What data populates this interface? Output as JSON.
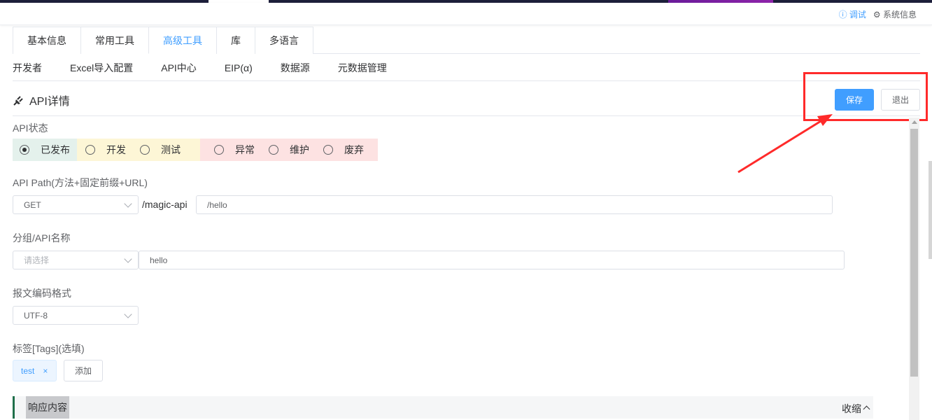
{
  "header": {
    "debug_link": "ⓘ 调试",
    "sysinfo_link": "⚙ 系统信息"
  },
  "tabs": [
    {
      "label": "基本信息"
    },
    {
      "label": "常用工具"
    },
    {
      "label": "高级工具",
      "active": true
    },
    {
      "label": "库"
    },
    {
      "label": "多语言"
    }
  ],
  "subnav": [
    {
      "label": "开发者"
    },
    {
      "label": "Excel导入配置"
    },
    {
      "label": "API中心"
    },
    {
      "label": "EIP(α)"
    },
    {
      "label": "数据源"
    },
    {
      "label": "元数据管理"
    }
  ],
  "section": {
    "title": "API详情",
    "icon": "plug-icon"
  },
  "actions": {
    "save_label": "保存",
    "exit_label": "退出"
  },
  "status": {
    "label": "API状态",
    "options": [
      {
        "label": "已发布",
        "selected": true
      },
      {
        "label": "开发"
      },
      {
        "label": "测试"
      },
      {
        "label": "异常"
      },
      {
        "label": "维护"
      },
      {
        "label": "废弃"
      }
    ],
    "colors": {
      "published": "#e4f1ec",
      "dev": "#fdf6d6",
      "error": "#fde2e2"
    }
  },
  "path": {
    "label": "API Path(方法+固定前缀+URL)",
    "method": "GET",
    "prefix": "/magic-api",
    "url": "/hello"
  },
  "group": {
    "label": "分组/API名称",
    "placeholder": "请选择",
    "name": "hello"
  },
  "encoding": {
    "label": "报文编码格式",
    "value": "UTF-8"
  },
  "tags": {
    "label": "标签[Tags](选填)",
    "items": [
      "test"
    ],
    "remove_glyph": "×",
    "add_label": "添加"
  },
  "response": {
    "title": "响应内容",
    "collapse_label": "收缩"
  },
  "colors": {
    "primary": "#409eff",
    "highlight_box": "#ff2a2a"
  }
}
